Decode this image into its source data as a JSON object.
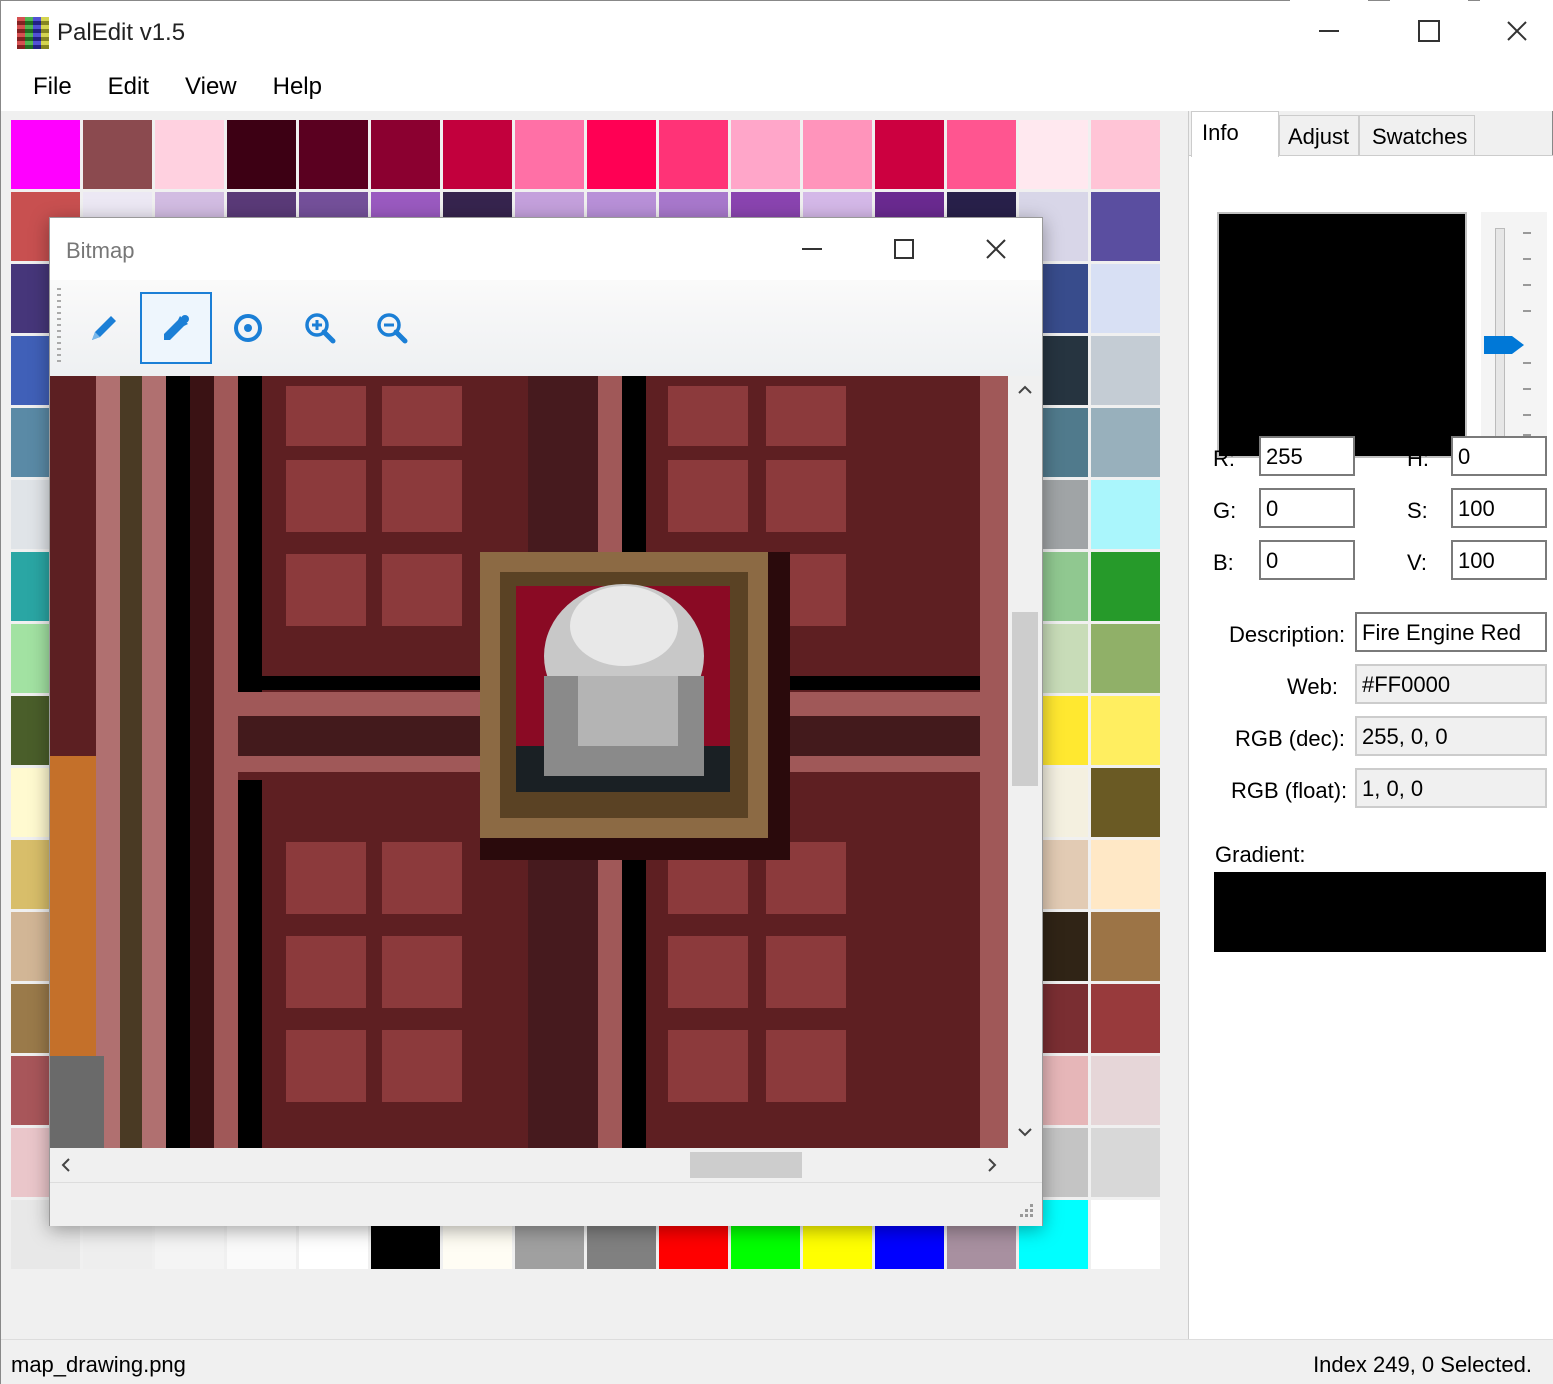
{
  "app": {
    "title": "PalEdit v1.5"
  },
  "window_controls": {
    "minimize": "—",
    "maximize": "☐",
    "close": "✕"
  },
  "menu": [
    "File",
    "Edit",
    "View",
    "Help"
  ],
  "palette_rows": [
    [
      "#ff00ff",
      "#8b4a4f",
      "#ffd1e0",
      "#3d0014",
      "#5a0020",
      "#8b0030",
      "#c2003d",
      "#ff70a6",
      "#ff0054",
      "#ff3377",
      "#ffa6c9",
      "#ff94bb",
      "#cc0040",
      "#ff5590",
      "#ffe8ef",
      "#ffc4d6"
    ],
    [
      "#c85050",
      "#ece8f4",
      "#d2bce2",
      "#5a3a78",
      "#74509a",
      "#9a5ac0",
      "#36244e",
      "#c4a0dc",
      "#b890d8",
      "#a878cc",
      "#8a44b0",
      "#d4b8e8",
      "#6a2a90",
      "#28204a",
      "#d8d6e8",
      "#5a4ea0"
    ],
    [
      "#46367a",
      "#e6e6f4",
      "#c8c8e6",
      "#9898cc",
      "#7070b0",
      "#5858a0",
      "#40408c",
      "#3a3a80",
      "#3240a0",
      "#5060c0",
      "#2a3488",
      "#8090d0",
      "#6070c0",
      "#3a4488",
      "#384c8c",
      "#d8e0f4"
    ],
    [
      "#4060b8",
      "#d0dcf0",
      "#a8c0e8",
      "#7898d8",
      "#5878c8",
      "#4060b0",
      "#3050a0",
      "#204090",
      "#2a3a5a",
      "#4a5a7a",
      "#6a7a9a",
      "#8a9aba",
      "#aabada",
      "#2c3e4c",
      "#263440",
      "#c4ccd4"
    ],
    [
      "#5a8aa6",
      "#d8e8f0",
      "#b0d0e0",
      "#88b8d0",
      "#60a0c0",
      "#4888a8",
      "#307090",
      "#285a78",
      "#a0c8d8",
      "#80b0c4",
      "#6090a4",
      "#407088",
      "#305868",
      "#203848",
      "#507a8c",
      "#98b0bc"
    ],
    [
      "#e0e4e8",
      "#c8d0d8",
      "#b0b8c0",
      "#98a0a8",
      "#808890",
      "#687078",
      "#505860",
      "#404850",
      "#cce8e8",
      "#aadddd",
      "#88d0d0",
      "#66c4c4",
      "#44b8b8",
      "#22acac",
      "#a0a4a6",
      "#aaf6fc"
    ],
    [
      "#2aa6a4",
      "#d8f4f0",
      "#b0e8e0",
      "#88dcd0",
      "#60d0c0",
      "#40c0b0",
      "#20b0a0",
      "#10a090",
      "#d8f0d8",
      "#b8e4b8",
      "#98d898",
      "#78cc78",
      "#58c058",
      "#38b438",
      "#90c890",
      "#269a2a"
    ],
    [
      "#a2e2a2",
      "#e8f6d8",
      "#d0ecb8",
      "#b8e298",
      "#a0d878",
      "#88ce58",
      "#70c438",
      "#58ba18",
      "#d0e0b0",
      "#c0d4a0",
      "#b0c890",
      "#a0bc80",
      "#90b070",
      "#80a460",
      "#c8dcb8",
      "#90b068"
    ],
    [
      "#4a5e2a",
      "#f4f0c0",
      "#ece8a0",
      "#e4e080",
      "#dcd860",
      "#d4d040",
      "#ccc820",
      "#c4c000",
      "#fff8a0",
      "#fff080",
      "#ffe860",
      "#ffe040",
      "#ffd820",
      "#ffd000",
      "#ffe830",
      "#ffee60"
    ],
    [
      "#fffad0",
      "#f8f4e0",
      "#f0ecd0",
      "#e8e4c0",
      "#e0dcb0",
      "#d8d4a0",
      "#d0cc90",
      "#c8c480",
      "#f4ecd8",
      "#ece0c4",
      "#e4d4b0",
      "#dcc89c",
      "#d4bc88",
      "#ccb074",
      "#f4f0e0",
      "#6a5a24"
    ],
    [
      "#d8be6a",
      "#f0e0c0",
      "#e8d0a8",
      "#e0c090",
      "#d8b078",
      "#d0a060",
      "#c89048",
      "#c08030",
      "#f0dcc8",
      "#e8ccb0",
      "#e0bc98",
      "#d8ac80",
      "#d09c68",
      "#c88c50",
      "#e2cbb4",
      "#ffe8c6"
    ],
    [
      "#d2b696",
      "#f0d8c0",
      "#e4c4a4",
      "#d8b088",
      "#cc9c6c",
      "#c08850",
      "#b47434",
      "#a86018",
      "#4a3a28",
      "#3e3020",
      "#342818",
      "#2a2010",
      "#201808",
      "#161000",
      "#302416",
      "#9c7446"
    ],
    [
      "#9a7a4a",
      "#e8c8c0",
      "#dcb0a8",
      "#d09890",
      "#c48078",
      "#b86860",
      "#ac5048",
      "#a03830",
      "#7a3a3a",
      "#6a2e2e",
      "#5a2222",
      "#4a1616",
      "#3a0a0a",
      "#2a0000",
      "#7a2e32",
      "#983a3c"
    ],
    [
      "#a8565a",
      "#f4e0e0",
      "#ecd0d0",
      "#e4c0c0",
      "#dcb0b0",
      "#d4a0a0",
      "#cc9090",
      "#c48080",
      "#f0d0d0",
      "#e8c0c0",
      "#e0b0b0",
      "#d8a0a0",
      "#d09090",
      "#c88080",
      "#e6b6b8",
      "#e6d6d8"
    ],
    [
      "#eac6ca",
      "#e8e8e8",
      "#e0e0e0",
      "#d8d8d8",
      "#d0d0d0",
      "#c8c8c8",
      "#c0c0c0",
      "#b8b8b8",
      "#e4e4e4",
      "#dcdcdc",
      "#d4d4d4",
      "#cccccc",
      "#c4c4c4",
      "#bcbcbc",
      "#c4c4c4",
      "#d8d8d8"
    ],
    [
      "#e8e8e8",
      "#eeeeee",
      "#f4f4f4",
      "#fafafa",
      "#ffffff",
      "#000000",
      "#fffdf4",
      "#a0a0a0",
      "#808080",
      "#ff0000",
      "#00ff00",
      "#ffff00",
      "#0000ff",
      "#a890a0",
      "#00ffff",
      "#ffffff"
    ]
  ],
  "tabs": [
    "Info",
    "Adjust",
    "Swatches"
  ],
  "info": {
    "r_label": "R:",
    "r_value": "255",
    "g_label": "G:",
    "g_value": "0",
    "b_label": "B:",
    "b_value": "0",
    "h_label": "H:",
    "h_value": "0",
    "s_label": "S:",
    "s_value": "100",
    "v_label": "V:",
    "v_value": "100",
    "description_label": "Description:",
    "description_value": "Fire Engine Red",
    "web_label": "Web:",
    "web_value": "#FF0000",
    "rgb_dec_label": "RGB (dec):",
    "rgb_dec_value": "255, 0, 0",
    "rgb_float_label": "RGB (float):",
    "rgb_float_value": "1, 0, 0",
    "gradient_label": "Gradient:",
    "preview_color": "#000000"
  },
  "status": {
    "file": "map_drawing.png",
    "selection": "Index 249, 0 Selected."
  },
  "bitmap_window": {
    "title": "Bitmap",
    "tools": [
      "pencil-icon",
      "eyedropper-icon",
      "reset-view-icon",
      "zoom-in-icon",
      "zoom-out-icon"
    ],
    "selected_tool": "eyedropper-icon"
  },
  "colors": {
    "accent": "#0078d7",
    "tool_accent": "#1b7fd6"
  }
}
